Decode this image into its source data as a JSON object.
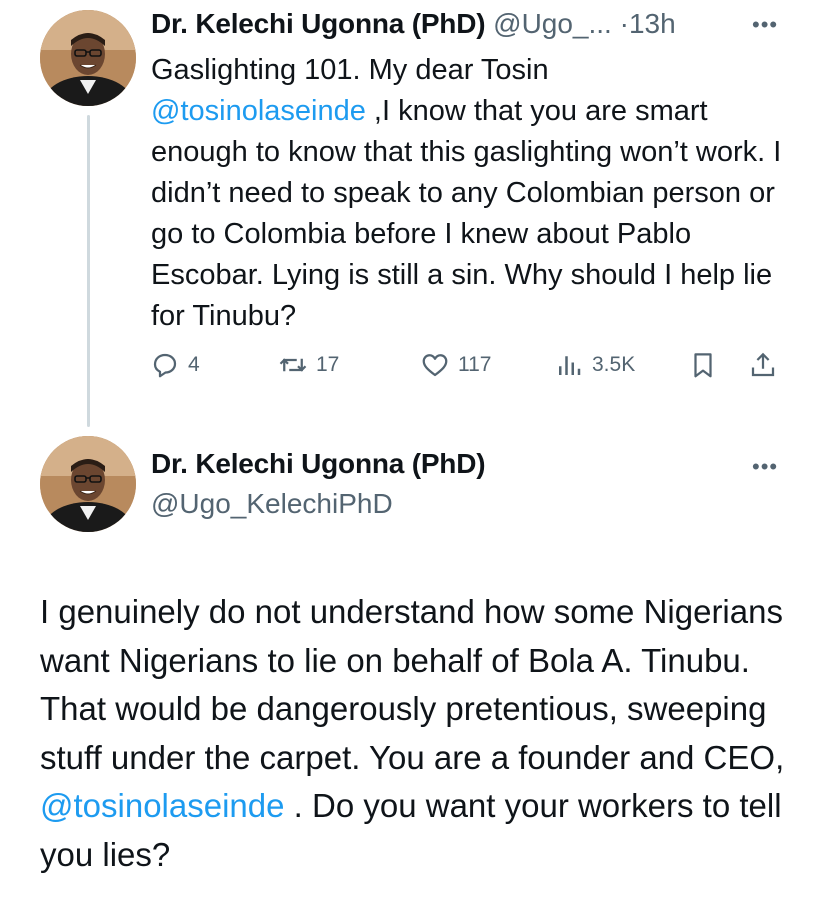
{
  "colors": {
    "text": "#0f1419",
    "secondary": "#536471",
    "link": "#1d9bf0",
    "thread_line": "#cfd9de"
  },
  "reply_tweet": {
    "author_name": "Dr. Kelechi Ugonna (PhD)",
    "handle": "@Ugo_...",
    "separator": "·",
    "time": "13h",
    "more_icon": "more-horizontal-icon",
    "text_before": "Gaslighting 101. My dear Tosin",
    "mention": "@tosinolaseinde",
    "text_after": ",I know that you are smart enough to know that this gaslighting won’t work. I didn’t need to speak to any Colombian person or go to Colombia before I knew about Pablo Escobar. Lying is still a sin. Why should I help lie for Tinubu?",
    "actions": {
      "replies": "4",
      "reposts": "17",
      "likes": "117",
      "views": "3.5K"
    }
  },
  "main_tweet": {
    "author_name": "Dr. Kelechi Ugonna (PhD)",
    "handle": "@Ugo_KelechiPhD",
    "more_icon": "more-horizontal-icon",
    "text_before": "I genuinely do not understand how some Nigerians want Nigerians to lie on behalf of Bola A. Tinubu. That would be dangerously pretentious, sweeping stuff under the carpet. You are a founder and CEO,",
    "mention": "@tosinolaseinde",
    "text_after": " . Do you want your workers to tell you lies?"
  }
}
